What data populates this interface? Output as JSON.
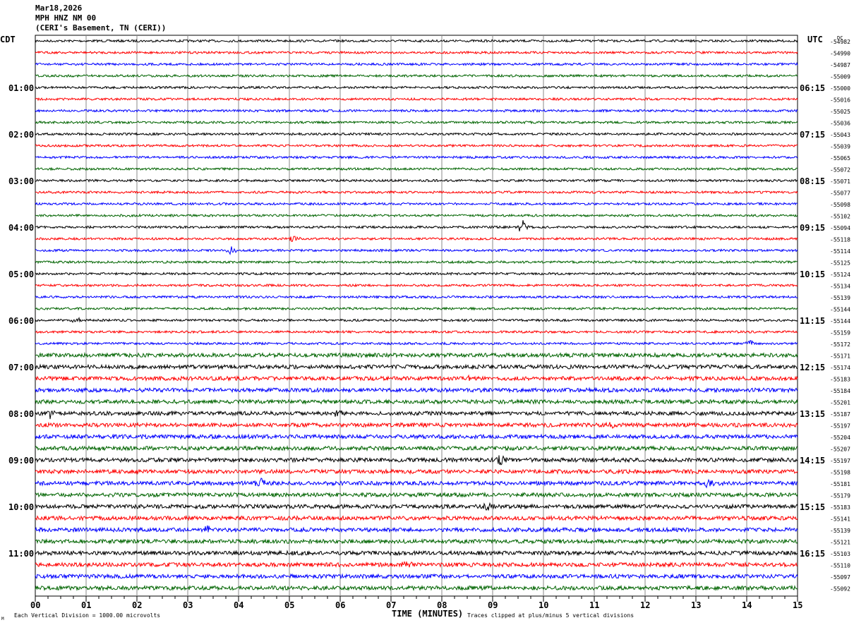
{
  "header": {
    "date": "Mar18,2026",
    "station": "MPH HNZ NM 00",
    "location": "(CERI's Basement, TN (CERI))"
  },
  "left_tz": "CDT",
  "right_tz": "UTC",
  "dc_label": "DC",
  "footer": {
    "scale_note": "Each Vertical Division = 1000.00 microvolts",
    "clip_note": "Traces clipped at plus/minus 5 vertical divisions",
    "mark": "M"
  },
  "chart_data": {
    "type": "line",
    "xlabel": "TIME (MINUTES)",
    "xlim": [
      0,
      15
    ],
    "x_ticks": [
      "00",
      "01",
      "02",
      "03",
      "04",
      "05",
      "06",
      "07",
      "08",
      "09",
      "10",
      "11",
      "12",
      "13",
      "14",
      "15"
    ],
    "grid": true,
    "trace_colors": [
      "#000000",
      "#ff0000",
      "#0000ff",
      "#006400"
    ],
    "left_hour_labels": [
      "01:00",
      "02:00",
      "03:00",
      "04:00",
      "05:00",
      "06:00",
      "07:00",
      "08:00",
      "09:00",
      "10:00",
      "11:00"
    ],
    "right_hour_labels": [
      "06:15",
      "07:15",
      "08:15",
      "09:15",
      "10:15",
      "11:15",
      "12:15",
      "13:15",
      "14:15",
      "15:15",
      "16:15"
    ],
    "dc_offsets": [
      -54982,
      -54990,
      -54987,
      -55009,
      -55000,
      -55016,
      -55025,
      -55036,
      -55043,
      -55039,
      -55065,
      -55072,
      -55071,
      -55077,
      -55098,
      -55102,
      -55094,
      -55118,
      -55114,
      -55125,
      -55124,
      -55134,
      -55139,
      -55144,
      -55144,
      -55159,
      -55172,
      -55171,
      -55174,
      -55183,
      -55184,
      -55201,
      -55187,
      -55197,
      -55204,
      -55207,
      -55197,
      -55198,
      -55181,
      -55179,
      -55183,
      -55141,
      -55139,
      -55121,
      -55103,
      -55110,
      -55097,
      -55092
    ],
    "events": [
      {
        "trace": 16,
        "minute": 9.6,
        "amplitude": 1.0
      },
      {
        "trace": 17,
        "minute": 5.1,
        "amplitude": 0.5
      },
      {
        "trace": 18,
        "minute": 3.85,
        "amplitude": 0.5
      },
      {
        "trace": 24,
        "minute": 0.8,
        "amplitude": 0.4
      },
      {
        "trace": 26,
        "minute": 14.05,
        "amplitude": 0.4
      },
      {
        "trace": 29,
        "minute": 8.5,
        "amplitude": 0.7
      },
      {
        "trace": 32,
        "minute": 0.3,
        "amplitude": 0.6
      },
      {
        "trace": 32,
        "minute": 5.95,
        "amplitude": 0.6
      },
      {
        "trace": 33,
        "minute": 11.35,
        "amplitude": 0.6
      },
      {
        "trace": 36,
        "minute": 9.15,
        "amplitude": 0.8
      },
      {
        "trace": 38,
        "minute": 4.45,
        "amplitude": 0.7
      },
      {
        "trace": 38,
        "minute": 13.25,
        "amplitude": 0.7
      },
      {
        "trace": 40,
        "minute": 8.9,
        "amplitude": 0.7
      },
      {
        "trace": 42,
        "minute": 3.4,
        "amplitude": 0.6
      },
      {
        "trace": 45,
        "minute": 7.3,
        "amplitude": 0.5
      }
    ]
  }
}
